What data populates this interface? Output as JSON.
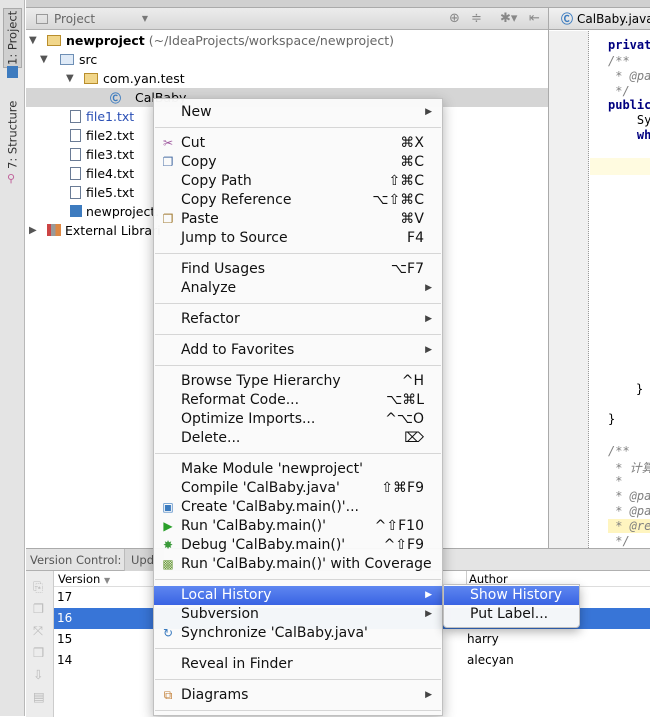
{
  "left_strip": {
    "tabs": [
      {
        "label": "1: Project"
      },
      {
        "label": "7: Structure"
      }
    ]
  },
  "project_panel": {
    "selector": "Project",
    "tree": [
      {
        "label": "newproject",
        "hint": "(~/IdeaProjects/workspace/newproject)",
        "icon": "module-icon"
      },
      {
        "label": "src",
        "icon": "folder-icon"
      },
      {
        "label": "com.yan.test",
        "icon": "package-icon"
      },
      {
        "label": "CalBaby",
        "icon": "class-icon"
      },
      {
        "label": "file1.txt",
        "icon": "file-icon"
      },
      {
        "label": "file2.txt",
        "icon": "file-icon"
      },
      {
        "label": "file3.txt",
        "icon": "file-icon"
      },
      {
        "label": "file4.txt",
        "icon": "file-icon"
      },
      {
        "label": "file5.txt",
        "icon": "file-icon"
      },
      {
        "label": "newproject.",
        "icon": "iml-icon"
      },
      {
        "label": "External Librari",
        "icon": "library-icon"
      }
    ]
  },
  "editor": {
    "tab": "CalBaby.java",
    "lines": [
      "privat",
      "/**",
      " * @pa",
      " */",
      "public",
      "    Sy",
      "    wh",
      "}",
      "}",
      "/**",
      " * 计算",
      " *",
      " * @pa",
      " * @pa",
      " * @re",
      " */"
    ]
  },
  "version_control": {
    "title": "Version Control:",
    "tab": "Upd",
    "columns": [
      "Version",
      "Author"
    ],
    "rows": [
      {
        "version": "17",
        "author": ""
      },
      {
        "version": "16",
        "author": "",
        "selected": true
      },
      {
        "version": "15",
        "author": "harry"
      },
      {
        "version": "14",
        "author": "alecyan"
      }
    ]
  },
  "context_menu": {
    "items": [
      {
        "label": "New",
        "submenu": true
      },
      {
        "sep": true
      },
      {
        "label": "Cut",
        "shortcut": "⌘X",
        "icon": "scissors-icon"
      },
      {
        "label": "Copy",
        "shortcut": "⌘C",
        "icon": "copy-icon"
      },
      {
        "label": "Copy Path",
        "shortcut": "⇧⌘C"
      },
      {
        "label": "Copy Reference",
        "shortcut": "⌥⇧⌘C"
      },
      {
        "label": "Paste",
        "shortcut": "⌘V",
        "icon": "paste-icon"
      },
      {
        "label": "Jump to Source",
        "shortcut": "F4"
      },
      {
        "sep": true
      },
      {
        "label": "Find Usages",
        "shortcut": "⌥F7"
      },
      {
        "label": "Analyze",
        "submenu": true
      },
      {
        "sep": true
      },
      {
        "label": "Refactor",
        "submenu": true
      },
      {
        "sep": true
      },
      {
        "label": "Add to Favorites",
        "submenu": true
      },
      {
        "sep": true
      },
      {
        "label": "Browse Type Hierarchy",
        "shortcut": "^H"
      },
      {
        "label": "Reformat Code...",
        "shortcut": "⌥⌘L"
      },
      {
        "label": "Optimize Imports...",
        "shortcut": "^⌥O"
      },
      {
        "label": "Delete...",
        "shortcut": "⌦"
      },
      {
        "sep": true
      },
      {
        "label": "Make Module 'newproject'"
      },
      {
        "label": "Compile 'CalBaby.java'",
        "shortcut": "⇧⌘F9"
      },
      {
        "label": "Create 'CalBaby.main()'...",
        "icon": "create-config-icon"
      },
      {
        "label": "Run 'CalBaby.main()'",
        "shortcut": "^⇧F10",
        "icon": "run-icon"
      },
      {
        "label": "Debug 'CalBaby.main()'",
        "shortcut": "^⇧F9",
        "icon": "debug-icon"
      },
      {
        "label": "Run 'CalBaby.main()' with Coverage",
        "icon": "coverage-icon"
      },
      {
        "sep": true
      },
      {
        "label": "Local History",
        "submenu": true,
        "highlighted": true
      },
      {
        "label": "Subversion",
        "submenu": true
      },
      {
        "label": "Synchronize 'CalBaby.java'",
        "icon": "sync-icon"
      },
      {
        "sep": true
      },
      {
        "label": "Reveal in Finder"
      },
      {
        "sep": true
      },
      {
        "label": "Diagrams",
        "submenu": true,
        "icon": "diagram-icon"
      },
      {
        "sep": true
      }
    ]
  },
  "submenu": {
    "items": [
      {
        "label": "Show History",
        "highlighted": true
      },
      {
        "label": "Put Label..."
      }
    ]
  },
  "colors": {
    "highlight": "#3a63e3",
    "selection": "#3875d7",
    "link_file": "#2a4fb5"
  }
}
